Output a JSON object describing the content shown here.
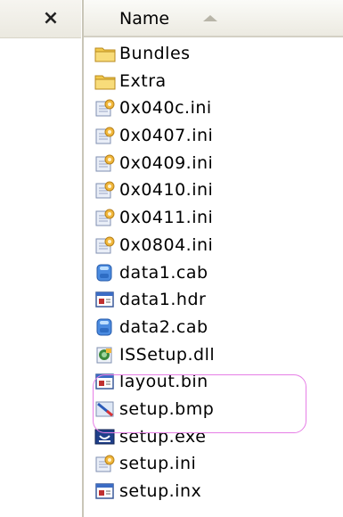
{
  "header": {
    "close_glyph": "×",
    "column_name": "Name"
  },
  "files": [
    {
      "name": "Bundles",
      "icon": "folder-icon"
    },
    {
      "name": "Extra",
      "icon": "folder-icon"
    },
    {
      "name": "0x040c.ini",
      "icon": "settings-file-icon"
    },
    {
      "name": "0x0407.ini",
      "icon": "settings-file-icon"
    },
    {
      "name": "0x0409.ini",
      "icon": "settings-file-icon"
    },
    {
      "name": "0x0410.ini",
      "icon": "settings-file-icon"
    },
    {
      "name": "0x0411.ini",
      "icon": "settings-file-icon"
    },
    {
      "name": "0x0804.ini",
      "icon": "settings-file-icon"
    },
    {
      "name": "data1.cab",
      "icon": "cabinet-icon"
    },
    {
      "name": "data1.hdr",
      "icon": "generic-file-icon"
    },
    {
      "name": "data2.cab",
      "icon": "cabinet-icon"
    },
    {
      "name": "ISSetup.dll",
      "icon": "dll-icon"
    },
    {
      "name": "layout.bin",
      "icon": "generic-file-icon"
    },
    {
      "name": "setup.bmp",
      "icon": "bitmap-icon"
    },
    {
      "name": "setup.exe",
      "icon": "installer-exe-icon"
    },
    {
      "name": "setup.ini",
      "icon": "settings-file-icon"
    },
    {
      "name": "setup.inx",
      "icon": "generic-file-icon"
    }
  ],
  "colors": {
    "highlight": "#e67ee6",
    "folder": "#f2c94c",
    "accent": "#3a6fd8"
  }
}
